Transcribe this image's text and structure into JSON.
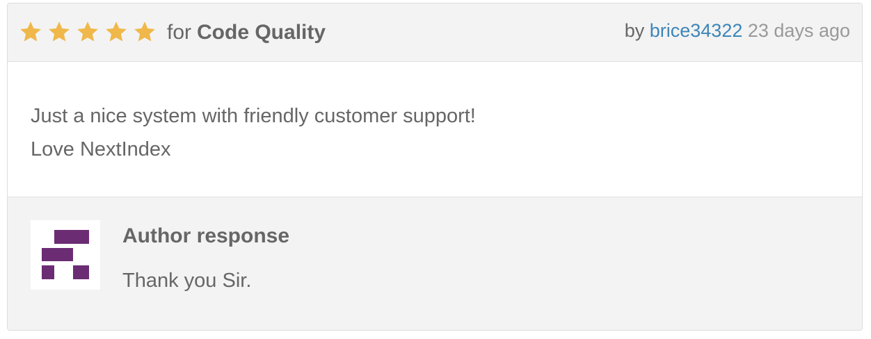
{
  "review": {
    "rating": 5,
    "rating_max": 5,
    "star_color": "#f0b84a",
    "star_icon": "star-icon",
    "for_prefix": "for",
    "category": "Code Quality",
    "by_prefix": "by",
    "author": "brice34322",
    "time_ago": "23 days ago",
    "link_color": "#3d85b8",
    "text_lines": [
      "Just a nice system with friendly customer support!",
      "Love NextIndex"
    ]
  },
  "response": {
    "title": "Author response",
    "text": "Thank you Sir.",
    "avatar_icon": "author-logo-icon",
    "avatar_color": "#6b2c73"
  }
}
